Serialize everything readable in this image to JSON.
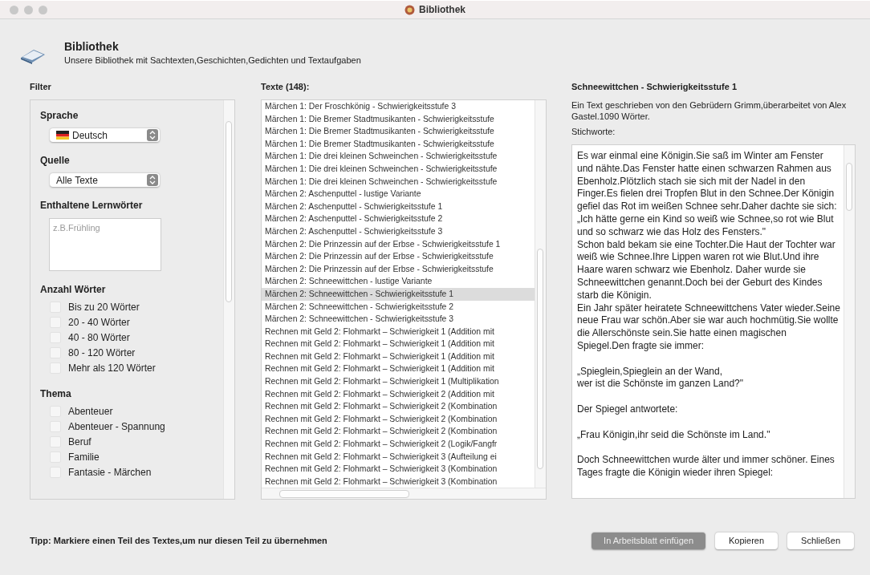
{
  "window": {
    "title": "Bibliothek"
  },
  "header": {
    "title": "Bibliothek",
    "subtitle": "Unsere Bibliothek mit Sachtexten,Geschichten,Gedichten und Textaufgaben"
  },
  "filter": {
    "heading": "Filter",
    "sprache": {
      "label": "Sprache",
      "value": "Deutsch"
    },
    "quelle": {
      "label": "Quelle",
      "value": "Alle Texte"
    },
    "lernwoerter": {
      "label": "Enthaltene Lernwörter",
      "placeholder": "z.B.Frühling"
    },
    "groups": [
      {
        "label": "Anzahl Wörter",
        "options": [
          {
            "label": "Bis zu 20 Wörter",
            "checked": false
          },
          {
            "label": "20 - 40 Wörter",
            "checked": false
          },
          {
            "label": "40 - 80 Wörter",
            "checked": false
          },
          {
            "label": "80 - 120 Wörter",
            "checked": false
          },
          {
            "label": "Mehr als 120 Wörter",
            "checked": false
          }
        ]
      },
      {
        "label": "Thema",
        "options": [
          {
            "label": "Abenteuer",
            "checked": false
          },
          {
            "label": "Abenteuer - Spannung",
            "checked": false
          },
          {
            "label": "Beruf",
            "checked": false
          },
          {
            "label": "Familie",
            "checked": false
          },
          {
            "label": "Fantasie - Märchen",
            "checked": false
          }
        ]
      }
    ]
  },
  "texts": {
    "heading": "Texte (148):",
    "items": [
      {
        "label": "Märchen 1: Der Froschkönig -  Schwierigkeitsstufe 3",
        "selected": false
      },
      {
        "label": "Märchen 1: Die Bremer Stadtmusikanten -  Schwierigkeitsstufe",
        "selected": false
      },
      {
        "label": "Märchen 1: Die Bremer Stadtmusikanten -  Schwierigkeitsstufe",
        "selected": false
      },
      {
        "label": "Märchen 1: Die Bremer Stadtmusikanten -  Schwierigkeitsstufe",
        "selected": false
      },
      {
        "label": "Märchen 1: Die drei kleinen Schweinchen -  Schwierigkeitsstufe",
        "selected": false
      },
      {
        "label": "Märchen 1: Die drei kleinen Schweinchen -  Schwierigkeitsstufe",
        "selected": false
      },
      {
        "label": "Märchen 1: Die drei kleinen Schweinchen -  Schwierigkeitsstufe",
        "selected": false
      },
      {
        "label": "Märchen 2: Aschenputtel - lustige Variante",
        "selected": false
      },
      {
        "label": "Märchen 2: Aschenputtel - Schwierigkeitsstufe 1",
        "selected": false
      },
      {
        "label": "Märchen 2: Aschenputtel - Schwierigkeitsstufe 2",
        "selected": false
      },
      {
        "label": "Märchen 2: Aschenputtel - Schwierigkeitsstufe 3",
        "selected": false
      },
      {
        "label": "Märchen 2: Die Prinzessin auf der Erbse - Schwierigkeitsstufe 1",
        "selected": false
      },
      {
        "label": "Märchen 2: Die Prinzessin auf der Erbse - Schwierigkeitsstufe",
        "selected": false
      },
      {
        "label": "Märchen 2: Die Prinzessin auf der Erbse - Schwierigkeitsstufe",
        "selected": false
      },
      {
        "label": "Märchen 2: Schneewittchen - lustige Variante",
        "selected": false
      },
      {
        "label": "Märchen 2: Schneewittchen - Schwierigkeitsstufe 1",
        "selected": true
      },
      {
        "label": "Märchen 2: Schneewittchen - Schwierigkeitsstufe 2",
        "selected": false
      },
      {
        "label": "Märchen 2: Schneewittchen - Schwierigkeitsstufe 3",
        "selected": false
      },
      {
        "label": "Rechnen mit Geld 2: Flohmarkt – Schwierigkeit 1 (Addition mit",
        "selected": false
      },
      {
        "label": "Rechnen mit Geld 2: Flohmarkt – Schwierigkeit 1 (Addition mit",
        "selected": false
      },
      {
        "label": "Rechnen mit Geld 2: Flohmarkt – Schwierigkeit 1 (Addition mit",
        "selected": false
      },
      {
        "label": "Rechnen mit Geld 2: Flohmarkt – Schwierigkeit 1 (Addition mit",
        "selected": false
      },
      {
        "label": "Rechnen mit Geld 2: Flohmarkt – Schwierigkeit 1 (Multiplikation",
        "selected": false
      },
      {
        "label": "Rechnen mit Geld 2: Flohmarkt – Schwierigkeit 2 (Addition mit",
        "selected": false
      },
      {
        "label": "Rechnen mit Geld 2: Flohmarkt – Schwierigkeit 2 (Kombination",
        "selected": false
      },
      {
        "label": "Rechnen mit Geld 2: Flohmarkt – Schwierigkeit 2 (Kombination",
        "selected": false
      },
      {
        "label": "Rechnen mit Geld 2: Flohmarkt – Schwierigkeit 2 (Kombination",
        "selected": false
      },
      {
        "label": "Rechnen mit Geld 2: Flohmarkt – Schwierigkeit 2 (Logik/Fangfr",
        "selected": false
      },
      {
        "label": "Rechnen mit Geld 2: Flohmarkt – Schwierigkeit 3 (Aufteilung ei",
        "selected": false
      },
      {
        "label": "Rechnen mit Geld 2: Flohmarkt – Schwierigkeit 3 (Kombination",
        "selected": false
      },
      {
        "label": "Rechnen mit Geld 2: Flohmarkt – Schwierigkeit 3 (Kombination",
        "selected": false
      }
    ]
  },
  "detail": {
    "title": "Schneewittchen - Schwierigkeitsstufe 1",
    "description": "Ein Text geschrieben von den Gebrüdern Grimm,überarbeitet von Alex Gastel.1090 Wörter.",
    "keywords_label": "Stichworte:",
    "story": "Es war einmal eine Königin.Sie saß im Winter am Fenster und nähte.Das Fenster hatte einen schwarzen Rahmen aus Ebenholz.Plötzlich stach sie sich mit der Nadel in den Finger.Es fielen drei Tropfen Blut in den Schnee.Der Königin gefiel das Rot im weißen Schnee sehr.Daher dachte sie sich: „Ich hätte gerne ein Kind so weiß wie Schnee,so rot wie Blut und so schwarz wie das Holz des Fensters.\"\nSchon bald bekam sie eine Tochter.Die Haut der Tochter war weiß wie Schnee.Ihre Lippen waren rot wie Blut.Und ihre Haare waren schwarz wie Ebenholz. Daher wurde sie Schneewittchen genannt.Doch bei der Geburt des Kindes starb die Königin.\nEin Jahr später heiratete Schneewittchens Vater wieder.Seine neue Frau war schön.Aber sie war auch hochmütig.Sie wollte die Allerschönste sein.Sie hatte einen magischen Spiegel.Den fragte sie immer:\n\n„Spieglein,Spieglein an der Wand,\nwer ist die Schönste im ganzen Land?\"\n\nDer Spiegel antwortete:\n\n„Frau Königin,ihr seid die Schönste im Land.\"\n\nDoch Schneewittchen wurde älter und immer schöner. Eines Tages fragte die Königin wieder ihren Spiegel:"
  },
  "tip": "Tipp: Markiere einen Teil des Textes,um nur diesen Teil zu übernehmen",
  "buttons": [
    {
      "label": "In Arbeitsblatt einfügen",
      "primary": true
    },
    {
      "label": "Kopieren",
      "primary": false
    },
    {
      "label": "Schließen",
      "primary": false
    }
  ]
}
